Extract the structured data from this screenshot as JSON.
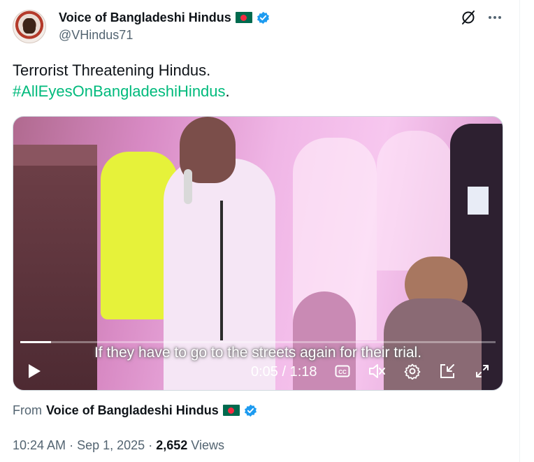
{
  "author": {
    "display_name": "Voice of Bangladeshi Hindus",
    "handle": "@VHindus71",
    "flag": "bangladesh-flag",
    "verified": true
  },
  "tweet": {
    "text": "Terrorist Threatening Hindus.",
    "hashtag": "#AllEyesOnBangladeshiHindus",
    "hashtag_suffix": "."
  },
  "video": {
    "caption": "If they have to go to the streets again for their trial.",
    "current_time": "0:05",
    "duration": "1:18",
    "time_display": "0:05 / 1:18",
    "progress": 0.064
  },
  "source": {
    "from_label": "From",
    "name": "Voice of Bangladeshi Hindus"
  },
  "meta": {
    "time": "10:24 AM",
    "separator": "·",
    "date": "Sep 1, 2025",
    "views_count": "2,652",
    "views_label": "Views"
  },
  "colors": {
    "hashtag": "#00ba7c",
    "verified": "#1d9bf0",
    "secondary_text": "#536471",
    "primary_text": "#0f1419"
  }
}
